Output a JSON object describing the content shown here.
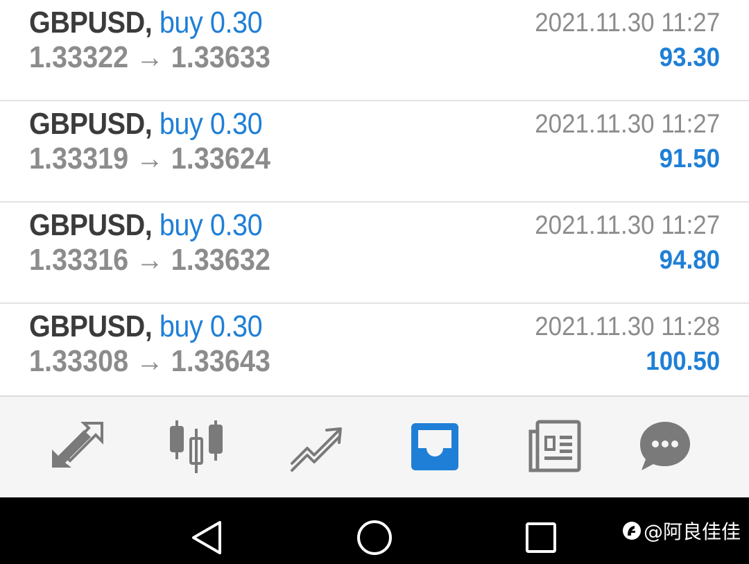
{
  "trades": [
    {
      "symbol": "GBPUSD,",
      "type": "buy 0.30",
      "open_price": "1.33322",
      "close_price": "1.33633",
      "arrow": "→",
      "time": "2021.11.30 11:27",
      "profit": "93.30"
    },
    {
      "symbol": "GBPUSD,",
      "type": "buy 0.30",
      "open_price": "1.33319",
      "close_price": "1.33624",
      "arrow": "→",
      "time": "2021.11.30 11:27",
      "profit": "91.50"
    },
    {
      "symbol": "GBPUSD,",
      "type": "buy 0.30",
      "open_price": "1.33316",
      "close_price": "1.33632",
      "arrow": "→",
      "time": "2021.11.30 11:27",
      "profit": "94.80"
    },
    {
      "symbol": "GBPUSD,",
      "type": "buy 0.30",
      "open_price": "1.33308",
      "close_price": "1.33643",
      "arrow": "→",
      "time": "2021.11.30 11:28",
      "profit": "100.50"
    }
  ],
  "tabs": [
    {
      "icon": "quotes-arrows-icon",
      "active": false
    },
    {
      "icon": "candlestick-chart-icon",
      "active": false
    },
    {
      "icon": "trade-trend-icon",
      "active": false
    },
    {
      "icon": "history-inbox-icon",
      "active": true
    },
    {
      "icon": "news-icon",
      "active": false
    },
    {
      "icon": "chat-bubble-icon",
      "active": false
    }
  ],
  "colors": {
    "accent": "#1f7fd6",
    "icon_inactive": "#7a7a7a",
    "text_dark": "#3b3b3b",
    "text_muted": "#8c8c8c",
    "tab_bar_bg": "#f5f5f5",
    "nav_bar_bg": "#000000"
  },
  "system_nav": [
    {
      "icon": "back-triangle-icon"
    },
    {
      "icon": "home-circle-icon"
    },
    {
      "icon": "recents-square-icon"
    }
  ],
  "watermark": {
    "logo_icon": "weibo-logo-icon",
    "text": "@阿良佳佳"
  }
}
